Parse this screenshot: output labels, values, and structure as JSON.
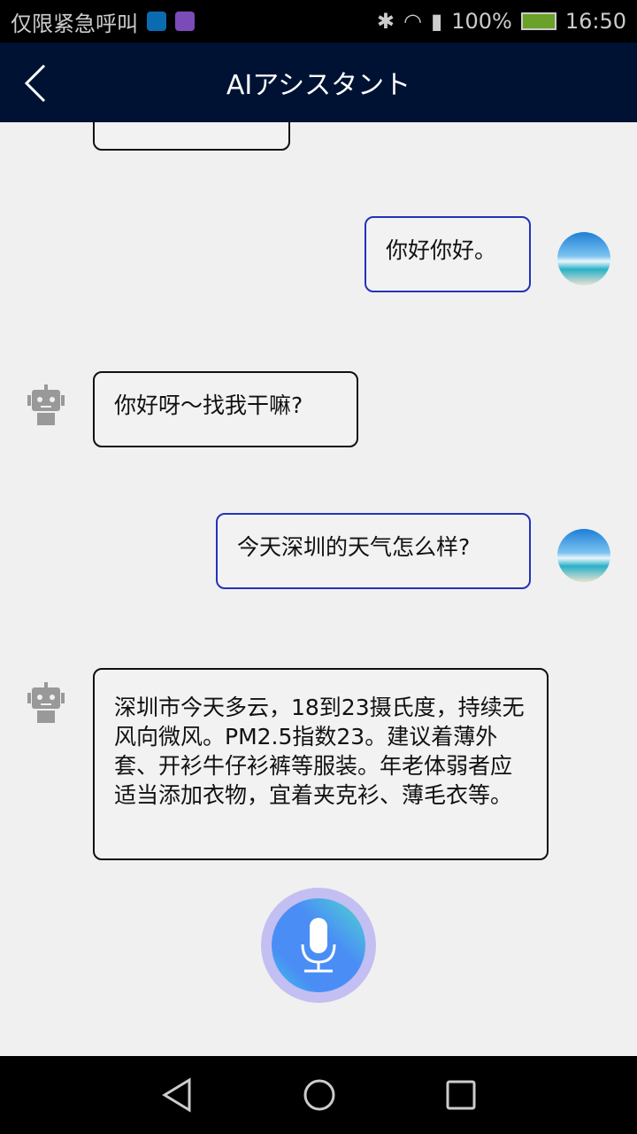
{
  "status_bar": {
    "carrier": "仅限紧急呼叫",
    "battery": "100%",
    "time": "16:50"
  },
  "header": {
    "title": "AIアシスタント"
  },
  "messages": [
    {
      "sender": "bot",
      "text": ""
    },
    {
      "sender": "user",
      "text": "你好你好。"
    },
    {
      "sender": "bot",
      "text": "你好呀～找我干嘛?"
    },
    {
      "sender": "user",
      "text": "今天深圳的天气怎么样?"
    },
    {
      "sender": "bot",
      "text": "深圳市今天多云，18到23摄氏度，持续无风向微风。PM2.5指数23。建议着薄外套、开衫牛仔衫裤等服装。年老体弱者应适当添加衣物，宜着夹克衫、薄毛衣等。"
    }
  ],
  "colors": {
    "appbar": "#001233",
    "user_border": "#2233bb"
  }
}
